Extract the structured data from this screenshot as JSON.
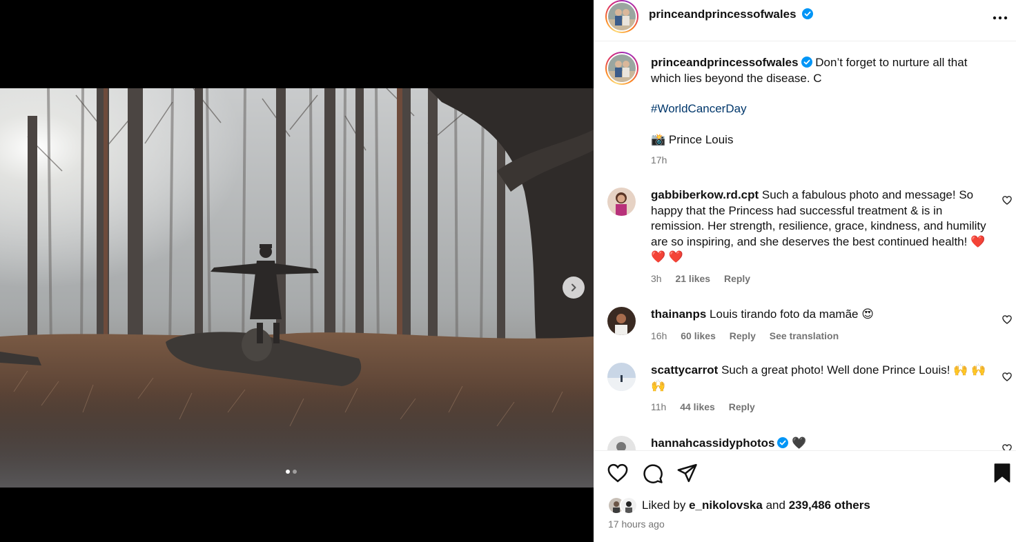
{
  "header": {
    "username": "princeandprincessofwales"
  },
  "caption": {
    "username": "princeandprincessofwales",
    "text": "Don’t forget to nurture all that which lies beyond the disease. C",
    "hashtag": "#WorldCancerDay",
    "camera_emoji": "📸",
    "credit": "Prince Louis",
    "time": "17h"
  },
  "comments": [
    {
      "username": "gabbiberkow.rd.cpt",
      "text": "Such a fabulous photo and message! So happy that the Princess had successful treatment & is in remission. Her strength, resilience, grace, kindness, and humility are so inspiring, and she deserves the best continued health! ❤️ ❤️ ❤️",
      "time": "3h",
      "likes": "21 likes",
      "reply": "Reply"
    },
    {
      "username": "thainanps",
      "text": "Louis tirando foto da mamãe 😍",
      "time": "16h",
      "likes": "60 likes",
      "reply": "Reply",
      "translate": "See translation"
    },
    {
      "username": "scattycarrot",
      "text": "Such a great photo! Well done Prince Louis! 🙌 🙌 🙌",
      "time": "11h",
      "likes": "44 likes",
      "reply": "Reply"
    },
    {
      "username": "hannahcassidyphotos",
      "text": "🖤"
    }
  ],
  "likes": {
    "prefix": "Liked by",
    "user": "e_nikolovska",
    "and": "and",
    "others": "239,486 others"
  },
  "posted": "17 hours ago",
  "carousel": {
    "slide": 1,
    "total": 2
  },
  "icons": [
    "heart-icon",
    "comment-icon",
    "share-icon",
    "bookmark-icon",
    "more-icon",
    "verified-icon",
    "chevron-right-icon"
  ],
  "colors": {
    "link": "#00376b",
    "verified": "#0095f6",
    "muted": "#737373"
  }
}
